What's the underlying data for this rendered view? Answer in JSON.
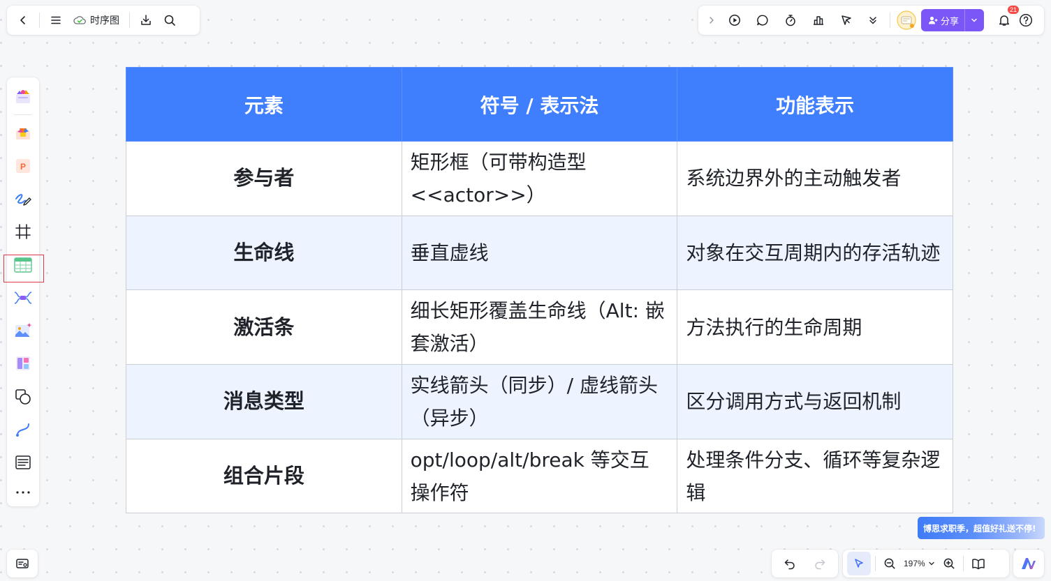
{
  "header": {
    "doc_title": "时序图"
  },
  "share": {
    "label": "分享"
  },
  "notifications": {
    "count": "21"
  },
  "table": {
    "headers": [
      "元素",
      "符号 / 表示法",
      "功能表示"
    ],
    "rows": [
      [
        "参与者",
        "矩形框（可带构造型 <<actor>>）",
        "系统边界外的主动触发者"
      ],
      [
        "生命线",
        "垂直虚线",
        "对象在交互周期内的存活轨迹"
      ],
      [
        "激活条",
        "细长矩形覆盖生命线（Alt: 嵌套激活）",
        "方法执行的生命周期"
      ],
      [
        "消息类型",
        "实线箭头（同步）/ 虚线箭头（异步）",
        "区分调用方式与返回机制"
      ],
      [
        "组合片段",
        "opt/loop/alt/break 等交互操作符",
        "处理条件分支、循环等复杂逻辑"
      ]
    ]
  },
  "zoom": {
    "level": "197%"
  },
  "promo": {
    "text": "博思求职季，超值好礼送不停!"
  },
  "colors": {
    "header_bg": "#3f7ffd",
    "alt_row_bg": "#edf3ff",
    "share_bg": "#7b57f7"
  }
}
